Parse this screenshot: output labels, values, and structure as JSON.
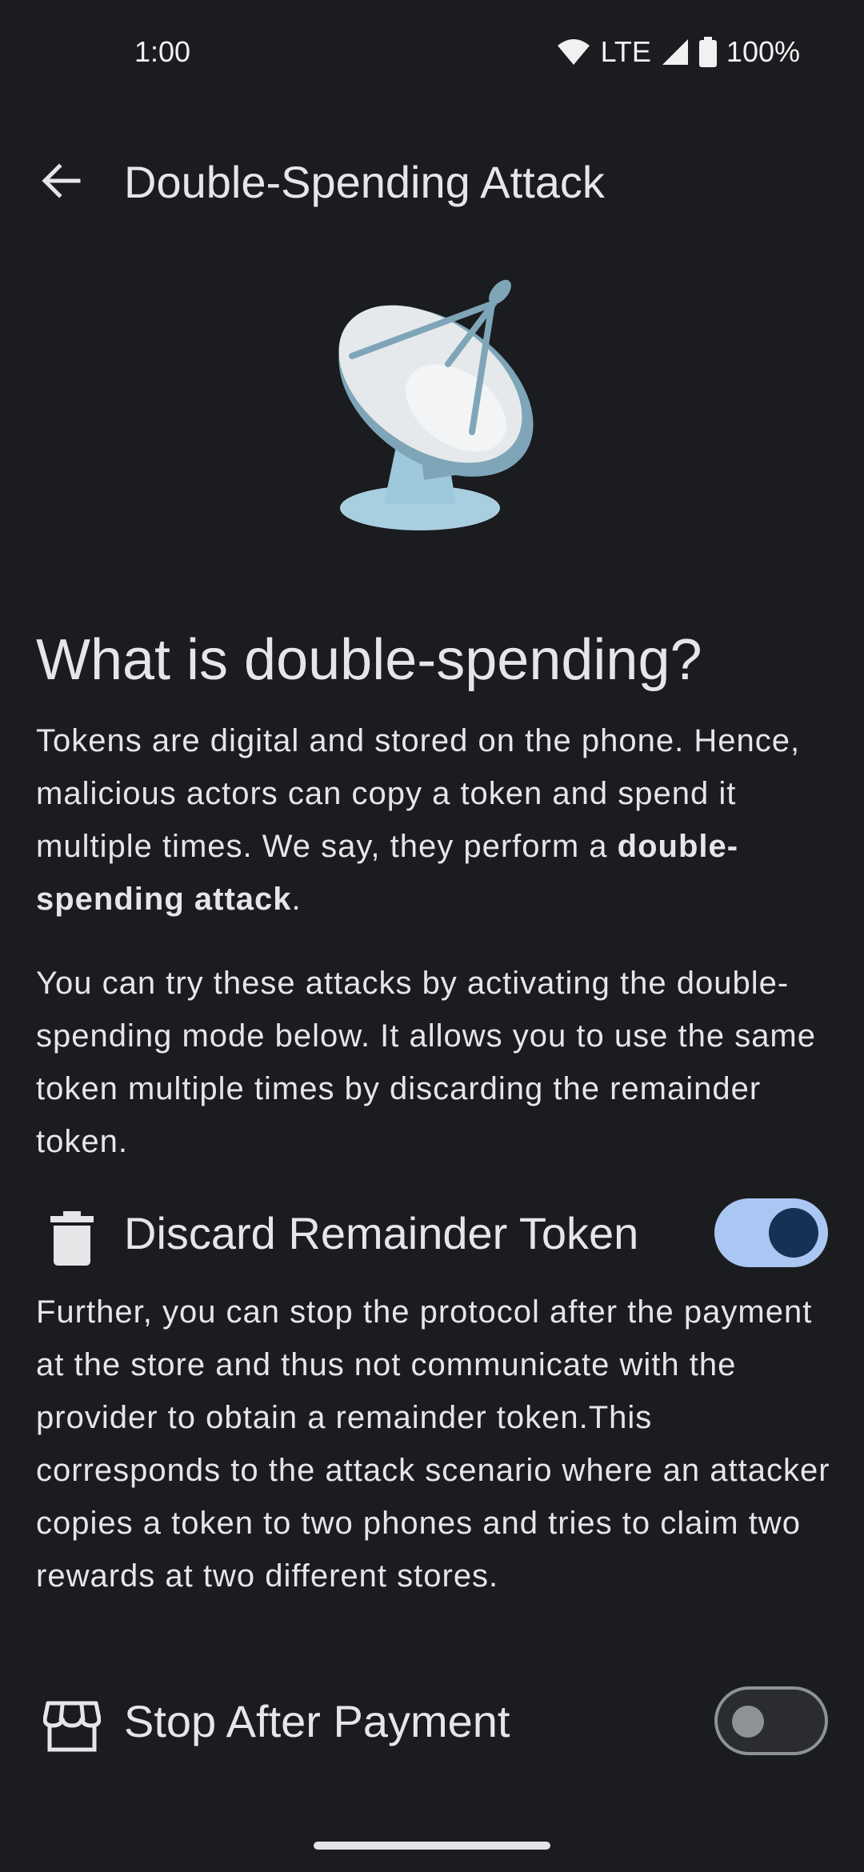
{
  "status_bar": {
    "time": "1:00",
    "network": "LTE",
    "battery": "100%"
  },
  "app_bar": {
    "title": "Double-Spending Attack",
    "back_icon": "arrow-back-icon"
  },
  "hero_icon": "satellite-dish-icon",
  "content": {
    "heading": "What is double-spending?",
    "para1_text": "Tokens are digital and stored on the phone. Hence, malicious actors can copy a token and spend it multiple times. We say, they perform a ",
    "para1_bold": "double-spending attack",
    "para1_end": ".",
    "para2": "You can try these attacks by activating the double-spending mode below. It allows you to use the same token multiple times by discarding the remainder token.",
    "para3": "Further, you can stop the protocol after the payment at the store and thus not communicate with the provider to obtain a remainder token.This corresponds to the attack scenario where an attacker copies a token to two phones and tries to claim two rewards at two different stores."
  },
  "settings": [
    {
      "label": "Discard Remainder Token",
      "icon": "delete-icon",
      "enabled": true
    },
    {
      "label": "Stop After Payment",
      "icon": "storefront-icon",
      "enabled": false
    }
  ],
  "colors": {
    "background": "#1b1c1f",
    "text": "#e6e6e9",
    "switch_on_track": "#a9c7f2",
    "switch_on_thumb": "#153256",
    "switch_off_outline": "#8e9196"
  }
}
